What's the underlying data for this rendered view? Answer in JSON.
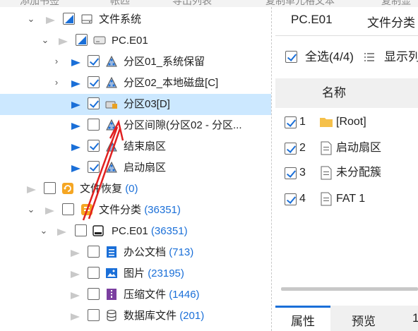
{
  "toolbar_top": {
    "items": [
      "添加书签",
      "帐匹",
      "导出列表",
      "复制单元格文本",
      "复制显"
    ]
  },
  "tree": {
    "filesystem": {
      "label": "文件系统"
    },
    "disk": {
      "label": "PC.E01"
    },
    "partitions": [
      {
        "label": "分区01_系统保留",
        "checked": true
      },
      {
        "label": "分区02_本地磁盘[C]",
        "checked": true
      },
      {
        "label": "分区03[D]",
        "checked": true,
        "selected": true
      },
      {
        "label": "分区间隙(分区02 - 分区...",
        "checked": false
      },
      {
        "label": "结束扇区",
        "checked": true
      },
      {
        "label": "启动扇区",
        "checked": true
      }
    ],
    "recovery": {
      "label": "文件恢复",
      "count": "(0)"
    },
    "classify": {
      "label": "文件分类",
      "count": "(36351)"
    },
    "classify_disk": {
      "label": "PC.E01",
      "count": "(36351)"
    },
    "categories": [
      {
        "label": "办公文档",
        "count": "(713)",
        "icon": "document-icon"
      },
      {
        "label": "图片",
        "count": "(23195)",
        "icon": "image-icon"
      },
      {
        "label": "压缩文件",
        "count": "(1446)",
        "icon": "archive-icon"
      },
      {
        "label": "数据库文件",
        "count": "(201)",
        "icon": "database-icon"
      }
    ]
  },
  "right_panel": {
    "tabs": [
      "PC.E01",
      "文件分类"
    ],
    "select_all": "全选(4/4)",
    "display_label": "显示列",
    "column_name": "名称",
    "rows": [
      {
        "index": "1",
        "name": "[Root]",
        "icon": "folder-icon"
      },
      {
        "index": "2",
        "name": "启动扇区",
        "icon": "file-icon"
      },
      {
        "index": "3",
        "name": "未分配簇",
        "icon": "file-icon"
      },
      {
        "index": "4",
        "name": "FAT 1",
        "icon": "file-icon"
      }
    ],
    "bottom_tabs": [
      "属性",
      "预览",
      "1"
    ]
  },
  "colors": {
    "accent": "#1a6fd8",
    "selection": "#cce8ff",
    "annotation_arrow": "#e02020"
  }
}
